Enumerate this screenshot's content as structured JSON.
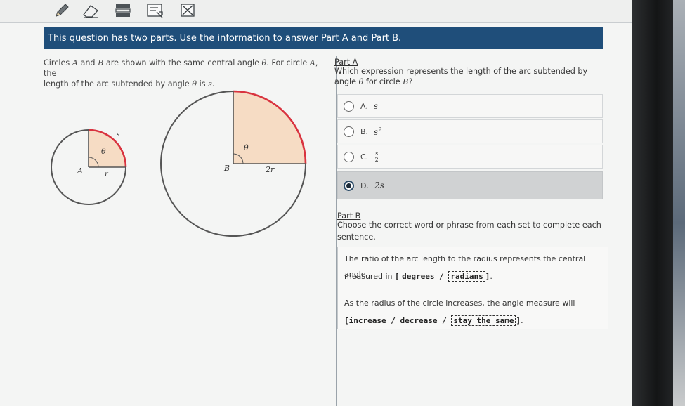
{
  "toolbar": {
    "tools": [
      {
        "icon": "pencil-icon"
      },
      {
        "icon": "eraser-icon"
      },
      {
        "icon": "line-reader-icon"
      },
      {
        "icon": "answer-masking-icon"
      },
      {
        "icon": "close-box-icon"
      }
    ]
  },
  "banner": {
    "text": "This question has two parts. Use the information to answer Part A and Part B."
  },
  "stem": {
    "line1_pre": "Circles ",
    "circle_a": "A",
    "and": " and ",
    "circle_b": "B",
    "line1_mid": " are shown with the same central angle ",
    "theta": "θ",
    "line1_end": ". For circle ",
    "circle_a2": "A",
    "line1_tail": ", the",
    "line2_pre": "length of the arc subtended by angle ",
    "theta2": "θ",
    "line2_mid": " is ",
    "s": "s",
    "period": "."
  },
  "figure_a": {
    "center_label": "A",
    "radius_label": "r",
    "arc_label": "s",
    "angle_label": "θ"
  },
  "figure_b": {
    "center_label": "B",
    "radius_label": "2r",
    "angle_label": "θ"
  },
  "part_a": {
    "title": "Part A",
    "question_line1": "Which expression represents the length of the arc subtended by",
    "question_line2_pre": "angle ",
    "theta": "θ",
    "question_line2_mid": " for circle ",
    "circle": "B",
    "question_line2_end": "?",
    "choices": [
      {
        "letter": "A.",
        "value": "s",
        "selected": false
      },
      {
        "letter": "B.",
        "base": "s",
        "exp": "2",
        "selected": false
      },
      {
        "letter": "C.",
        "num": "s",
        "den": "2",
        "selected": false
      },
      {
        "letter": "D.",
        "value": "2s",
        "selected": true
      }
    ]
  },
  "part_b": {
    "title": "Part B",
    "question_line1": "Choose the correct word or phrase from each set to complete each",
    "question_line2": "sentence.",
    "s1_line1": "The ratio of the arc length to the radius represents the central angle",
    "s1_line2_pre": "measured in ",
    "s1_open": "[",
    "s1_opt1": "degrees",
    "s1_sep": " / ",
    "s1_opt2": "radians",
    "s1_close": "]",
    "s1_end": ".",
    "s2_line1": "As the radius of the circle increases, the angle measure will",
    "s2_open": "[",
    "s2_opt1": "increase",
    "s2_sep1": " / ",
    "s2_opt2": "decrease",
    "s2_sep2": " / ",
    "s2_opt3": "stay the same",
    "s2_close": "]",
    "s2_end": "."
  },
  "colors": {
    "banner": "#1f4e7a",
    "arc": "#d9333f",
    "sector": "#f6dcc4",
    "selected_choice": "#d0d2d3"
  }
}
